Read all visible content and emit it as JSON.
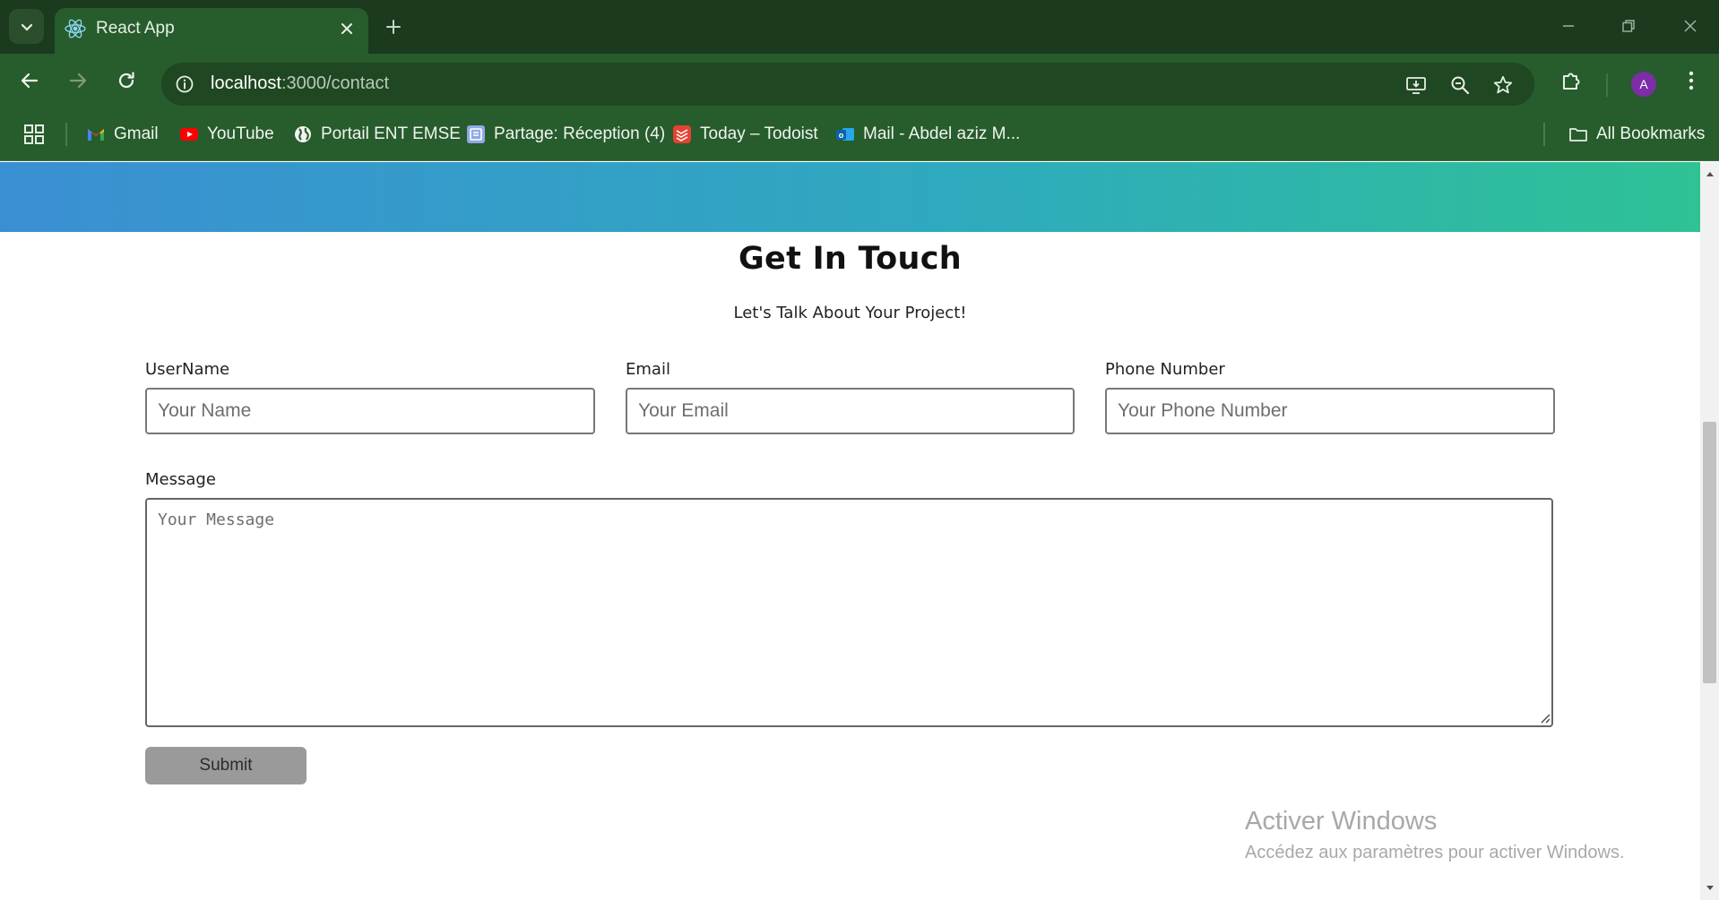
{
  "browser": {
    "tab": {
      "title": "React App"
    },
    "url": {
      "host": "localhost",
      "path": ":3000/contact"
    },
    "profile_initial": "A",
    "bookmarks": [
      {
        "label": "Gmail",
        "icon": "gmail-icon"
      },
      {
        "label": "YouTube",
        "icon": "youtube-icon"
      },
      {
        "label": "Portail ENT EMSE",
        "icon": "globe-icon"
      },
      {
        "label": "Partage: Réception (4)",
        "icon": "partage-icon"
      },
      {
        "label": "Today – Todoist",
        "icon": "todoist-icon"
      },
      {
        "label": "Mail - Abdel aziz M...",
        "icon": "outlook-icon"
      }
    ],
    "all_bookmarks_label": "All Bookmarks"
  },
  "page": {
    "title": "Get In Touch",
    "subtitle": "Let's Talk About Your Project!",
    "form": {
      "username": {
        "label": "UserName",
        "placeholder": "Your Name",
        "value": ""
      },
      "email": {
        "label": "Email",
        "placeholder": "Your Email",
        "value": ""
      },
      "phone": {
        "label": "Phone Number",
        "placeholder": "Your Phone Number",
        "value": ""
      },
      "message": {
        "label": "Message",
        "placeholder": "Your Message",
        "value": ""
      },
      "submit_label": "Submit"
    }
  },
  "watermark": {
    "title": "Activer Windows",
    "subtitle": "Accédez aux paramètres pour activer Windows."
  },
  "colors": {
    "chrome_dark": "#1b3a1e",
    "chrome": "#275c2c",
    "hero_gradient_start": "#3a8fd3",
    "hero_gradient_end": "#2ec295",
    "submit_bg": "#9a9a9a"
  }
}
